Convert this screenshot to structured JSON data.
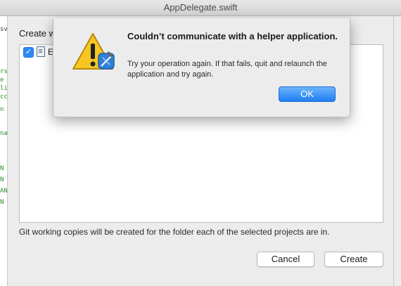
{
  "window": {
    "title": "AppDelegate.swift"
  },
  "editor_fragments": [
    {
      "text": "sv",
      "color": "#333333"
    },
    {
      "text": "rs",
      "color": "#2e8b2e"
    },
    {
      "text": "e",
      "color": "#2e8b2e"
    },
    {
      "text": "li",
      "color": "#2e8b2e"
    },
    {
      "text": "cc",
      "color": "#2e8b2e"
    },
    {
      "text": "n",
      "color": "#2e8b2e"
    },
    {
      "text": "na",
      "color": "#2e8b2e"
    },
    {
      "text": "N",
      "color": "#2e8b2e"
    },
    {
      "text": "N",
      "color": "#2e8b2e"
    },
    {
      "text": "AN",
      "color": "#2e8b2e"
    },
    {
      "text": "N",
      "color": "#2e8b2e"
    }
  ],
  "sheet": {
    "title": "Create w",
    "project": {
      "checked": true,
      "name": "E"
    },
    "footnote": "Git working copies will be created for the folder each of the selected projects are in.",
    "cancel_label": "Cancel",
    "create_label": "Create"
  },
  "alert": {
    "icon": "xcode-warning-icon",
    "title": "Couldn’t communicate with a helper application.",
    "message": "Try your operation again. If that fails, quit and relaunch the application and try again.",
    "ok_label": "OK"
  }
}
